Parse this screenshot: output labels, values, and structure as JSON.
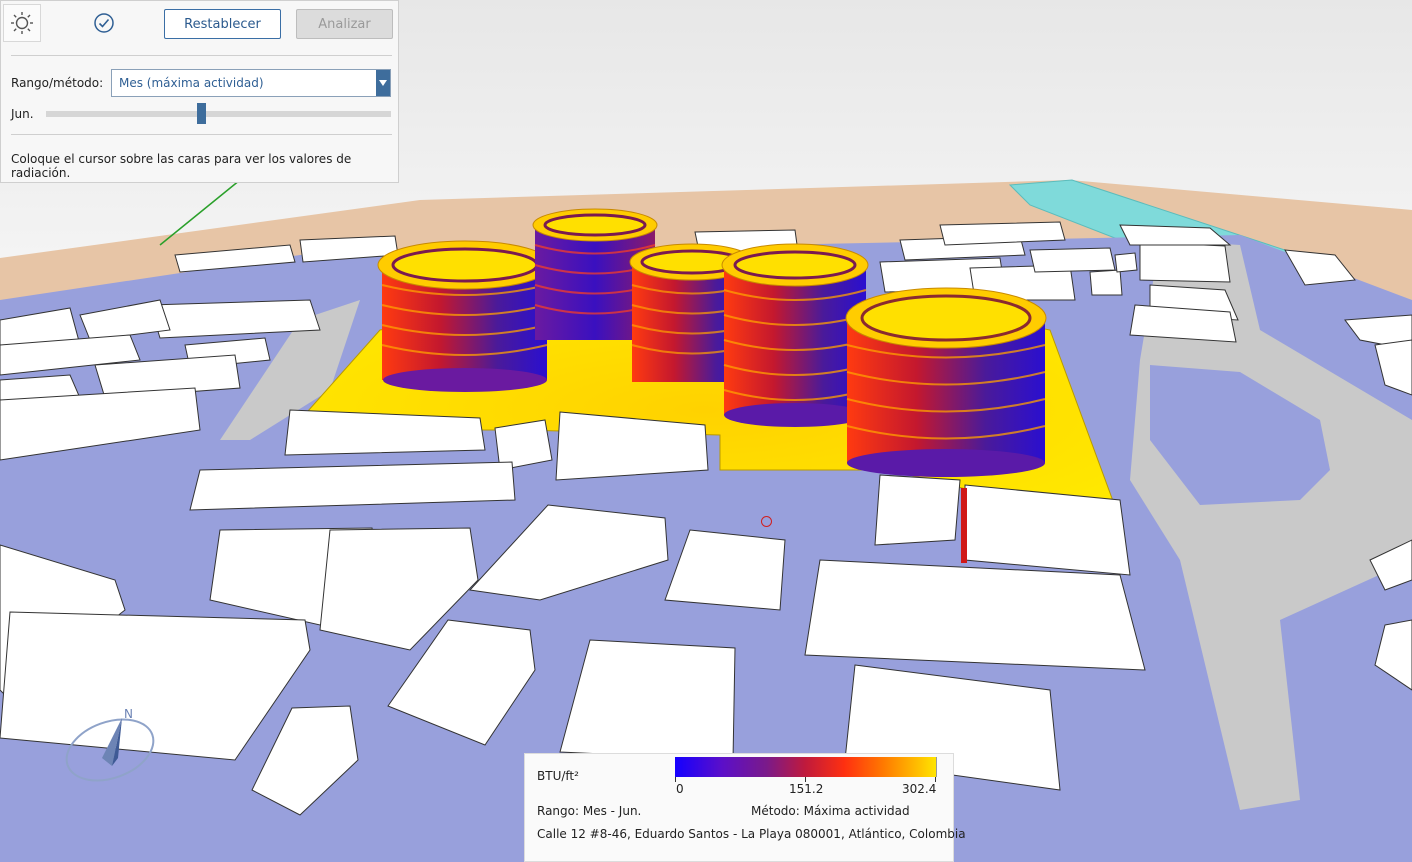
{
  "toolbar": {
    "sun_icon": "sun-settings-icon",
    "check_icon": "check-circle-icon",
    "reset_label": "Restablecer",
    "analyze_label": "Analizar"
  },
  "range_method": {
    "label": "Rango/método:",
    "selected": "Mes (máxima actividad)"
  },
  "slider": {
    "label": "Jun.",
    "value_fraction": 0.45
  },
  "hint": "Coloque el cursor sobre las caras para ver los valores de radiación.",
  "legend": {
    "unit": "BTU/ft²",
    "min_label": "0",
    "mid_label": "151.2",
    "max_label": "302.4",
    "range_text": "Rango: Mes - Jun.",
    "method_text": "Método: Máxima actividad",
    "address": "Calle 12 #8-46, Eduardo Santos - La Playa 080001, Atlántico, Colombia",
    "colors": [
      "#1500ff",
      "#7a1a8a",
      "#ff3010",
      "#ffe400"
    ]
  },
  "scene": {
    "colors": {
      "sky": "#eeeeee",
      "ground": "#e7c5a6",
      "plaza": "#98a0dc",
      "road": "#c9c9c9",
      "building": "#ffffff",
      "water": "#7fdada"
    }
  }
}
